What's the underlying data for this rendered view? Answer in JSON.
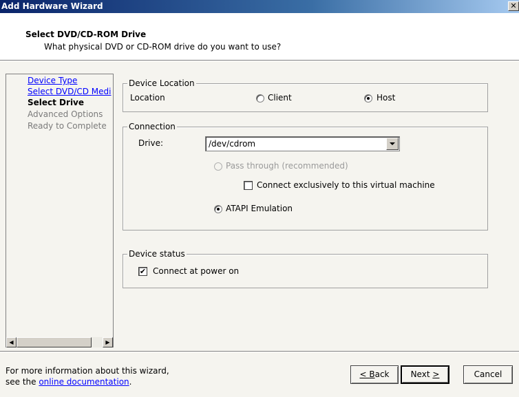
{
  "window": {
    "title": "Add Hardware Wizard",
    "close_glyph": "✕"
  },
  "header": {
    "title": "Select DVD/CD-ROM Drive",
    "subtitle": "What physical DVD or CD-ROM drive do you want to use?"
  },
  "steps": [
    {
      "label": "Device Type",
      "state": "link"
    },
    {
      "label": "Select DVD/CD Medi",
      "state": "link"
    },
    {
      "label": "Select Drive",
      "state": "current"
    },
    {
      "label": "Advanced Options",
      "state": "disabled"
    },
    {
      "label": "Ready to Complete",
      "state": "disabled"
    }
  ],
  "device_location": {
    "legend": "Device Location",
    "label": "Location",
    "client_label": "Client",
    "host_label": "Host",
    "selected": "Host"
  },
  "connection": {
    "legend": "Connection",
    "drive_label": "Drive:",
    "drive_value": "/dev/cdrom",
    "passthrough_label": "Pass through (recommended)",
    "exclusive_label": "Connect exclusively to this virtual machine",
    "exclusive_checked": false,
    "atapi_label": "ATAPI Emulation",
    "mode_selected": "ATAPI Emulation"
  },
  "device_status": {
    "legend": "Device status",
    "connect_label": "Connect at power on",
    "connect_checked": true,
    "check_glyph": "✔"
  },
  "footer": {
    "info_line1": "For more information about this wizard,",
    "info_line2_prefix": "see the ",
    "doc_link": "online documentation",
    "info_line2_suffix": "."
  },
  "buttons": {
    "back_mnemonic": "B",
    "back_rest": "ack",
    "back_prefix": "< ",
    "next_text": "Next ",
    "next_suffix": ">",
    "cancel": "Cancel"
  },
  "scroll_glyphs": {
    "left": "◀",
    "right": "▶"
  }
}
